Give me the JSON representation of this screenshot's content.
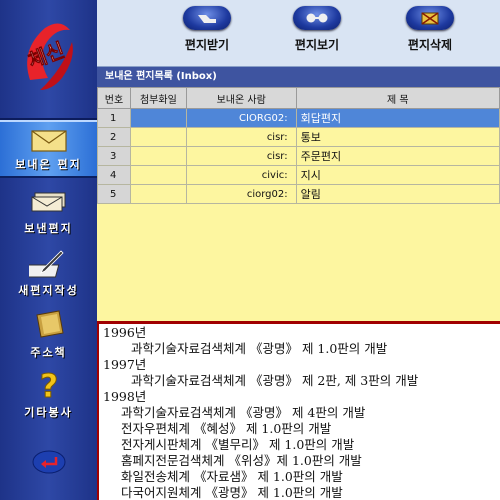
{
  "sidebar": {
    "logo_text": "체신",
    "items": [
      {
        "label": "보내온 편지",
        "icon": "envelope-icon",
        "active": true
      },
      {
        "label": "보낸편지",
        "icon": "envelope-stack-icon",
        "active": false
      },
      {
        "label": "새편지작성",
        "icon": "pen-write-icon",
        "active": false
      },
      {
        "label": "주소책",
        "icon": "address-book-icon",
        "active": false
      },
      {
        "label": "기타봉사",
        "icon": "question-icon",
        "active": false
      }
    ],
    "exit_icon": "return-arrow-icon"
  },
  "toolbar": {
    "receive_label": "편지받기",
    "view_label": "편지보기",
    "delete_label": "편지삭제"
  },
  "inbox_title": "보내온 편지목록 (Inbox)",
  "table": {
    "headers": {
      "num": "번호",
      "attach": "첨부화일",
      "sender": "보내온 사람",
      "subject": "제 목"
    },
    "rows": [
      {
        "num": "1",
        "attach": "",
        "sender": "CIORG02:",
        "subject": "회답편지",
        "selected": true
      },
      {
        "num": "2",
        "attach": "",
        "sender": "cisr:",
        "subject": "통보",
        "selected": false
      },
      {
        "num": "3",
        "attach": "",
        "sender": "cisr:",
        "subject": "주문편지",
        "selected": false
      },
      {
        "num": "4",
        "attach": "",
        "sender": "civic:",
        "subject": "지시",
        "selected": false
      },
      {
        "num": "5",
        "attach": "",
        "sender": "ciorg02:",
        "subject": "알림",
        "selected": false
      }
    ]
  },
  "preview": {
    "lines": [
      {
        "text": "1996년",
        "style": "y"
      },
      {
        "text": "과학기술자료검색체계 《광명》 제 1.0판의 개발",
        "style": "i1"
      },
      {
        "text": "1997년",
        "style": "y"
      },
      {
        "text": "과학기술자료검색체계 《광명》 제 2판, 제 3판의 개발",
        "style": "i1"
      },
      {
        "text": "1998년",
        "style": "y"
      },
      {
        "text": "과학기술자료검색체계 《광명》 제 4판의 개발",
        "style": "i2"
      },
      {
        "text": "전자우편체계 《혜성》 제 1.0판의 개발",
        "style": "i2"
      },
      {
        "text": "전자게시판체계 《별무리》 제 1.0판의 개발",
        "style": "i2"
      },
      {
        "text": "홈페지전문검색체계 《위성》제 1.0판의 개발",
        "style": "i2"
      },
      {
        "text": "화일전송체계 《자료샘》 제 1.0판의 개발",
        "style": "i2"
      },
      {
        "text": "다국어지원체계 《광명》 제 1.0판의 개발",
        "style": "i2"
      }
    ]
  },
  "colors": {
    "sidebar_bg": "#2a3f94",
    "active_nav": "#4f92ea",
    "list_bg": "#fdf6a0",
    "selected_row": "#4f86d8",
    "divider": "#a00000"
  }
}
